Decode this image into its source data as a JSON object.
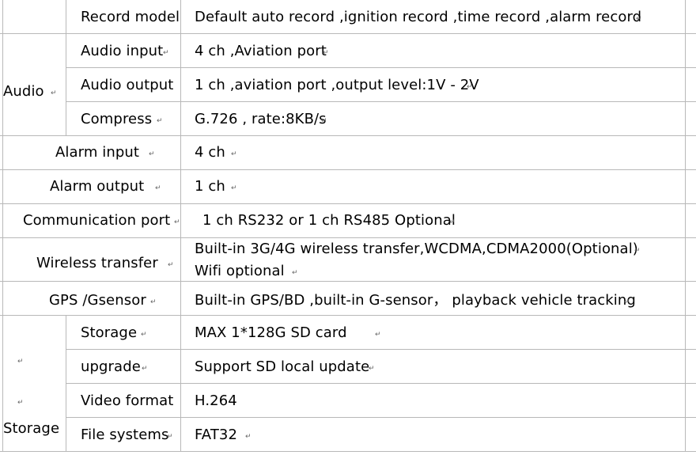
{
  "mark": "↵",
  "rows": {
    "record_model": {
      "label": "Record model",
      "value": "Default auto record ,ignition record ,time record ,alarm record"
    },
    "audio": {
      "group": "Audio",
      "input_label": "Audio input",
      "input_value": "4 ch ,Aviation port",
      "output_label": "Audio output",
      "output_value": "1 ch ,aviation port ,output level:1V - 2V",
      "compress_label": "Compress",
      "compress_value": "G.726 , rate:8KB/s"
    },
    "alarm_input": {
      "label": "Alarm input",
      "value": "4 ch"
    },
    "alarm_output": {
      "label": "Alarm output",
      "value": "1 ch"
    },
    "communication_port": {
      "label": "Communication port",
      "value": "1 ch RS232 or 1 ch RS485 Optional"
    },
    "wireless": {
      "label": "Wireless transfer",
      "value_line1": "Built-in 3G/4G wireless transfer,WCDMA,CDMA2000(Optional)",
      "value_line2": "Wifi optional"
    },
    "gps": {
      "label": "GPS /Gsensor",
      "value": "Built-in GPS/BD ,built-in G-sensor， playback vehicle tracking"
    },
    "storage": {
      "group": "Storage",
      "storage_label": "Storage",
      "storage_value": "MAX 1*128G SD card",
      "upgrade_label": "upgrade",
      "upgrade_value": "Support SD local update",
      "video_label": "Video format",
      "video_value": "H.264",
      "fs_label": "File systems",
      "fs_value": "FAT32"
    }
  }
}
